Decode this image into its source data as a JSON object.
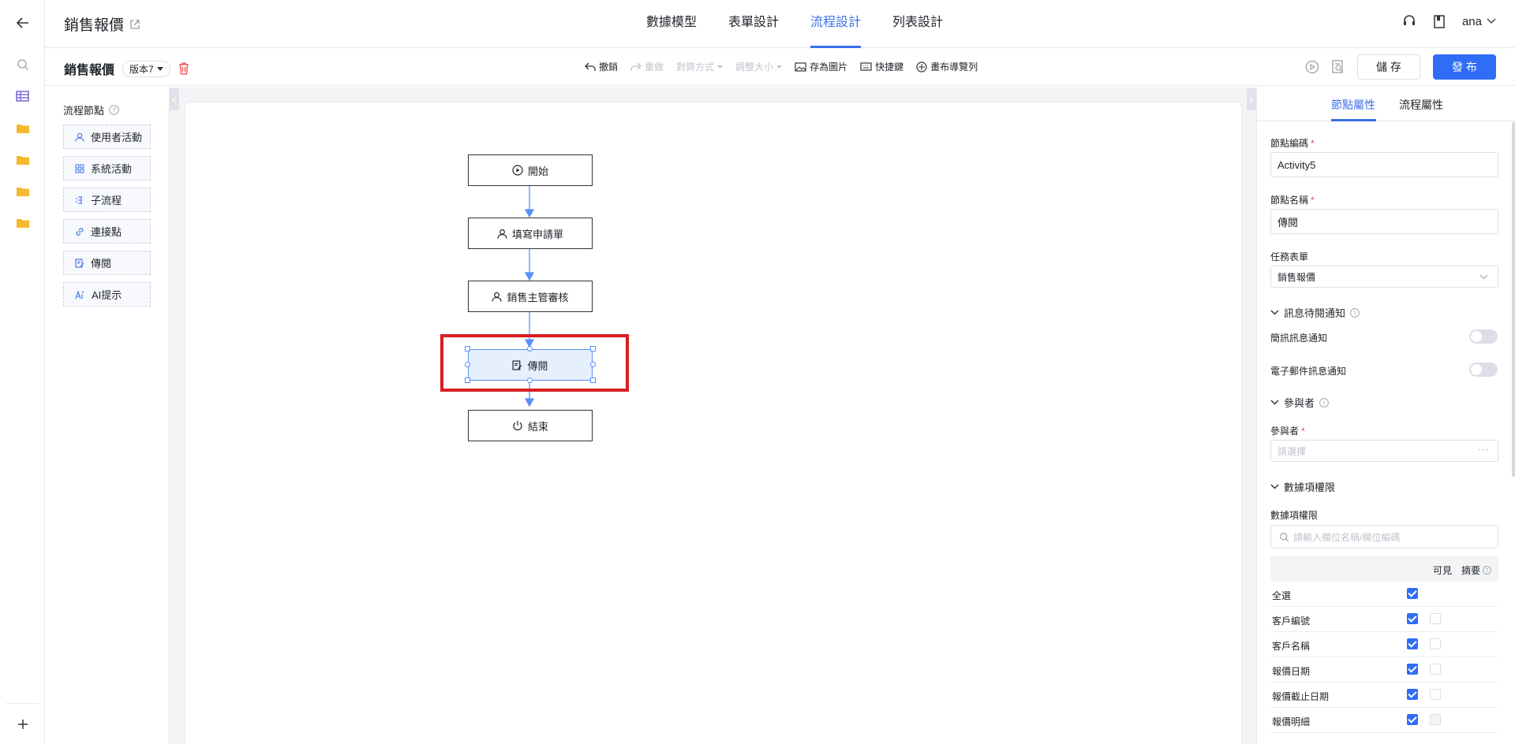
{
  "app": {
    "title": "銷售報價",
    "user": "ana"
  },
  "top_tabs": [
    {
      "label": "數據模型"
    },
    {
      "label": "表單設計"
    },
    {
      "label": "流程設計"
    },
    {
      "label": "列表設計"
    }
  ],
  "toolbar": {
    "title": "銷售報價",
    "version": "版本7",
    "undo": "撤銷",
    "redo": "重做",
    "align": "對齊方式",
    "resize": "調整大小",
    "save_image": "存為圖片",
    "shortcuts": "快捷鍵",
    "canvas_nav": "畫布導覽列",
    "save": "儲 存",
    "publish": "發 布"
  },
  "palette": {
    "title": "流程節點",
    "items": [
      {
        "label": "使用者活動",
        "icon": "user-icon"
      },
      {
        "label": "系統活動",
        "icon": "grid-icon"
      },
      {
        "label": "子流程",
        "icon": "subflow-icon"
      },
      {
        "label": "連接點",
        "icon": "link-icon"
      },
      {
        "label": "傳閱",
        "icon": "circulate-icon"
      },
      {
        "label": "AI提示",
        "icon": "ai-icon"
      }
    ]
  },
  "flow": {
    "nodes": [
      {
        "label": "開始",
        "icon": "play-circle-icon"
      },
      {
        "label": "填寫申請單",
        "icon": "user-icon"
      },
      {
        "label": "銷售主管審核",
        "icon": "user-icon"
      },
      {
        "label": "傳閱",
        "icon": "circulate-icon"
      },
      {
        "label": "結束",
        "icon": "power-icon"
      }
    ],
    "accent": "#5b8ff9",
    "highlight_color": "#d81e22"
  },
  "panel": {
    "tabs": [
      {
        "label": "節點屬性"
      },
      {
        "label": "流程屬性"
      }
    ],
    "code_label": "節點編碼",
    "code_value": "Activity5",
    "name_label": "節點名稱",
    "name_value": "傳閱",
    "form_label": "任務表單",
    "form_value": "銷售報價",
    "notify_section": "訊息待閱通知",
    "sms_label": "簡訊訊息通知",
    "email_label": "電子郵件訊息通知",
    "participants_section": "參與者",
    "participants_label": "參與者",
    "participants_placeholder": "請選擇",
    "data_section": "數據項權限",
    "data_label": "數據項權限",
    "search_placeholder": "請輸入欄位名稱/欄位編碼",
    "col_visible": "可見",
    "col_summary": "摘要",
    "rows": [
      {
        "name": "全選",
        "visible": true,
        "summary": null
      },
      {
        "name": "客戶編號",
        "visible": true,
        "summary": false
      },
      {
        "name": "客戶名稱",
        "visible": true,
        "summary": false
      },
      {
        "name": "報價日期",
        "visible": true,
        "summary": false
      },
      {
        "name": "報價截止日期",
        "visible": true,
        "summary": false
      },
      {
        "name": "報價明細",
        "visible": true,
        "summary": "disabled"
      }
    ],
    "brand_color": "#2f6df6"
  }
}
